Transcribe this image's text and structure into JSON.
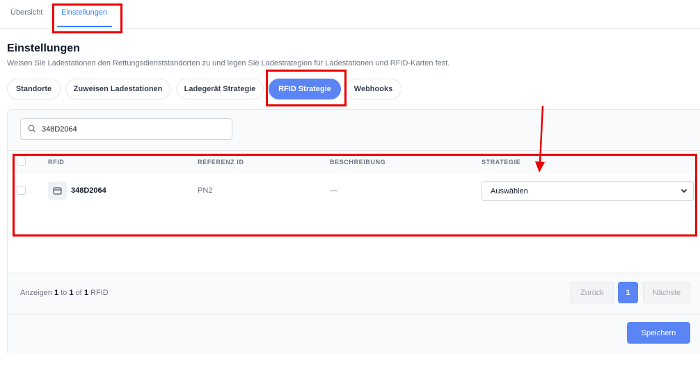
{
  "top_tabs": [
    {
      "label": "Übersicht"
    },
    {
      "label": "Einstellungen",
      "active": true
    }
  ],
  "page": {
    "title": "Einstellungen",
    "subtitle": "Weisen Sie Ladestationen den Rettungsdienststandorten zu und legen Sie Ladestrategien für Ladestationen und RFID-Karten fest."
  },
  "settings_tabs": [
    {
      "label": "Standorte"
    },
    {
      "label": "Zuweisen Ladestationen"
    },
    {
      "label": "Ladegerät Strategie"
    },
    {
      "label": "RFID Strategie",
      "active": true
    },
    {
      "label": "Webhooks"
    }
  ],
  "search": {
    "value": "348D2064",
    "icon": "search-icon"
  },
  "table": {
    "headers": [
      "RFID",
      "REFERENZ ID",
      "BESCHREIBUNG",
      "STRATEGIE"
    ],
    "rows": [
      {
        "rfid": "348D2064",
        "reference_id": "PN2",
        "description": "—",
        "strategy": "Auswählen",
        "icon": "card-icon"
      }
    ]
  },
  "pagination": {
    "prefix": "Anzeigen",
    "from": "1",
    "to_word": "to",
    "to": "1",
    "of_word": "of",
    "total": "1",
    "unit": "RFID",
    "prev_label": "Zurück",
    "page": "1",
    "next_label": "Nächste"
  },
  "actions": {
    "save_label": "Speichern"
  },
  "colors": {
    "accent": "#5b85f5",
    "annotation": "#ee0000"
  }
}
